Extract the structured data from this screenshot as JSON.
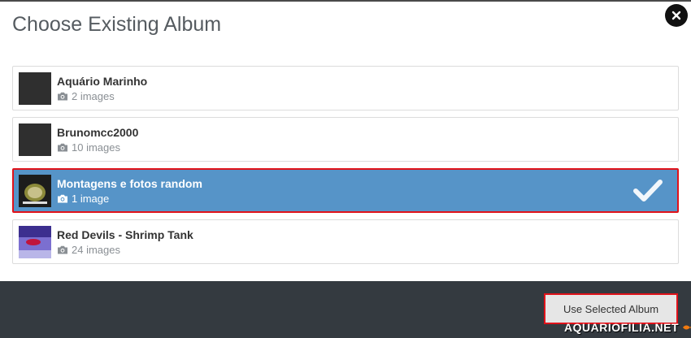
{
  "modal": {
    "title": "Choose Existing Album"
  },
  "albums": [
    {
      "name": "Aquário Marinho",
      "count": "2 images",
      "selected": false
    },
    {
      "name": "Brunomcc2000",
      "count": "10 images",
      "selected": false
    },
    {
      "name": "Montagens e fotos random",
      "count": "1 image",
      "selected": true
    },
    {
      "name": "Red Devils - Shrimp Tank",
      "count": "24 images",
      "selected": false
    }
  ],
  "footer": {
    "use_button_label": "Use Selected Album"
  },
  "watermark": {
    "text": "AQUARIOFILIA.NET"
  },
  "colors": {
    "selected_bg": "#5694c8",
    "highlight_border": "#e0121a",
    "footer_bg": "#343a40"
  },
  "icons": {
    "close": "close-icon",
    "count": "camera-icon",
    "selected": "checkmark-icon"
  }
}
